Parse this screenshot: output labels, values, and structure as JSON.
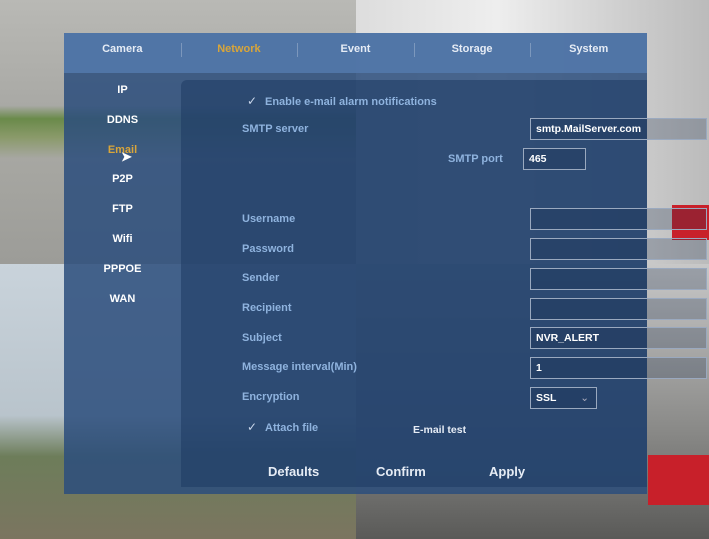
{
  "tabs": [
    "Camera",
    "Network",
    "Event",
    "Storage",
    "System"
  ],
  "active_tab": "Network",
  "sidebar": [
    "IP",
    "DDNS",
    "Email",
    "P2P",
    "FTP",
    "Wifi",
    "PPPOE",
    "WAN"
  ],
  "active_sidebar": "Email",
  "enable_label": "Enable e-mail alarm notifications",
  "enable_checked": true,
  "smtp_server": {
    "label": "SMTP server",
    "value": "smtp.MailServer.com"
  },
  "smtp_port": {
    "label": "SMTP port",
    "value": "465"
  },
  "fields": [
    {
      "label": "Username",
      "value": ""
    },
    {
      "label": "Password",
      "value": ""
    },
    {
      "label": "Sender",
      "value": ""
    },
    {
      "label": "Recipient",
      "value": ""
    },
    {
      "label": "Subject",
      "value": "NVR_ALERT"
    },
    {
      "label": "Message interval(Min)",
      "value": "1"
    }
  ],
  "encryption": {
    "label": "Encryption",
    "value": "SSL"
  },
  "attach_label": "Attach file",
  "attach_checked": true,
  "email_test": "E-mail test",
  "buttons": {
    "defaults": "Defaults",
    "confirm": "Confirm",
    "apply": "Apply"
  },
  "accent_color": "#d8a53a"
}
